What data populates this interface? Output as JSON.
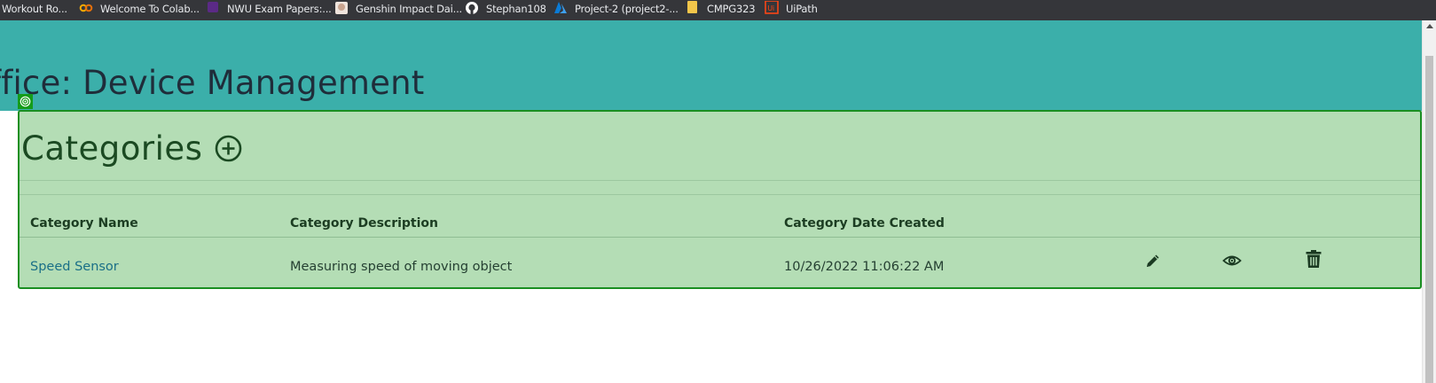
{
  "bookmarks": [
    {
      "label": "Workout Ro...",
      "icon": "bookmark-icon"
    },
    {
      "label": "Welcome To Colab...",
      "icon": "colab-icon"
    },
    {
      "label": "NWU Exam Papers:...",
      "icon": "nwu-icon"
    },
    {
      "label": "Genshin Impact Dai...",
      "icon": "genshin-icon"
    },
    {
      "label": "Stephan108",
      "icon": "github-icon"
    },
    {
      "label": "Project-2 (project2-...",
      "icon": "azure-icon"
    },
    {
      "label": "CMPG323",
      "icon": "folder-icon"
    },
    {
      "label": "UiPath",
      "icon": "uipath-icon"
    }
  ],
  "header": {
    "title": "ffice: Device Management"
  },
  "categories": {
    "title": "Categories",
    "add_icon": "plus-circle-icon",
    "columns": [
      "Category Name",
      "Category Description",
      "Category Date Created"
    ],
    "rows": [
      {
        "name": "Speed Sensor",
        "description": "Measuring speed of moving object",
        "date_created": "10/26/2022 11:06:22 AM",
        "actions": [
          "pencil-icon",
          "eye-icon",
          "trash-icon"
        ]
      }
    ]
  },
  "colors": {
    "header_band": "#3bafaa",
    "panel_bg": "#b4ddb5",
    "panel_border": "#1a8f22",
    "link": "#1a6f87",
    "bookmarks_bar": "#35363a"
  }
}
